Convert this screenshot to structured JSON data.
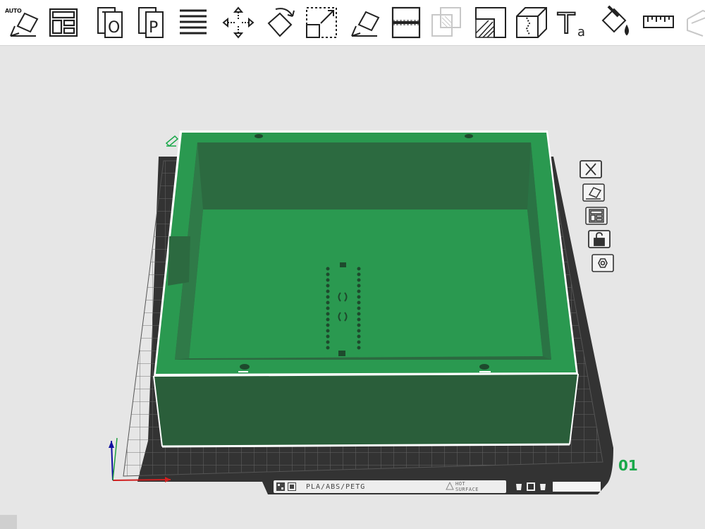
{
  "toolbar": {
    "auto_label": "AUTO",
    "tools": [
      {
        "name": "auto-orient",
        "icon": "auto-orient-icon"
      },
      {
        "name": "arrange",
        "icon": "arrange-icon"
      },
      {
        "name": "object",
        "icon": "object-icon"
      },
      {
        "name": "part",
        "icon": "part-icon"
      },
      {
        "name": "objects-list",
        "icon": "list-icon"
      },
      {
        "name": "move",
        "icon": "move-icon"
      },
      {
        "name": "rotate",
        "icon": "rotate-icon"
      },
      {
        "name": "scale",
        "icon": "scale-icon"
      },
      {
        "name": "place-on-face",
        "icon": "place-on-face-icon"
      },
      {
        "name": "cut",
        "icon": "cut-icon"
      },
      {
        "name": "boolean",
        "icon": "boolean-icon"
      },
      {
        "name": "support-painting",
        "icon": "support-painting-icon"
      },
      {
        "name": "seam-painting",
        "icon": "seam-painting-icon"
      },
      {
        "name": "text",
        "icon": "text-icon"
      },
      {
        "name": "color-painting",
        "icon": "color-painting-icon"
      },
      {
        "name": "measure",
        "icon": "ruler-icon"
      },
      {
        "name": "assembly",
        "icon": "assembly-icon"
      }
    ],
    "text_tool_glyph": "T",
    "text_tool_sub": "a",
    "object_glyph": "O",
    "part_glyph": "P"
  },
  "plate": {
    "number": "01",
    "material": "PLA/ABS/PETG",
    "surface_line1": "HOT",
    "surface_line2": "SURFACE"
  },
  "plate_buttons": [
    {
      "name": "delete-plate",
      "icon": "close-icon"
    },
    {
      "name": "auto-orient-plate",
      "icon": "auto-orient-icon"
    },
    {
      "name": "arrange-plate",
      "icon": "arrange-icon"
    },
    {
      "name": "lock-plate",
      "icon": "lock-icon"
    },
    {
      "name": "plate-settings",
      "icon": "settings-hex-icon"
    }
  ],
  "colors": {
    "model_light": "#2a9950",
    "model_dark": "#2a5e3a",
    "model_side": "#326e44",
    "plate_bg": "#3a3a3a",
    "accent": "#1aa84a"
  }
}
